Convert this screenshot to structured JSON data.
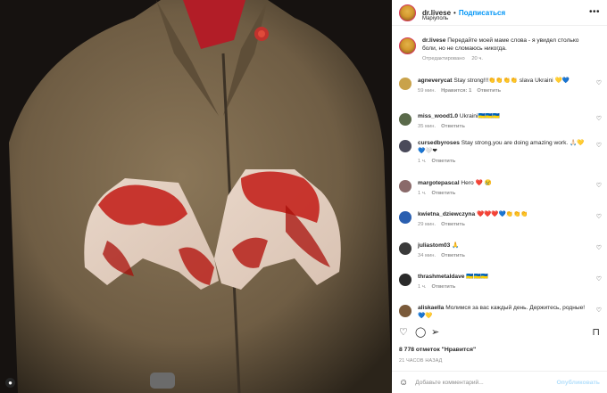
{
  "post": {
    "username": "dr.livese",
    "follow_label": "Подписаться",
    "location": "Маріуполь",
    "caption": "Передайте моей маме слова - я увидел столько боли, но не сломаюсь никогда.",
    "edited": "Отредактировано",
    "caption_time": "20 ч."
  },
  "comments": [
    {
      "user": "agneverycat",
      "text": "Stay strong!!!👏👏👏👏 slava Ukraini 💛💙",
      "time": "59 мин.",
      "likes": "Нравится: 1",
      "reply": "Ответить",
      "avatar_color": "#c9a24a"
    },
    {
      "user": "miss_wood1.0",
      "text": "Ukraini🇺🇦🇺🇦🇺🇦",
      "time": "35 мин.",
      "likes": "",
      "reply": "Ответить",
      "avatar_color": "#5a6a4a"
    },
    {
      "user": "cursedbyroses",
      "text": "Stay strong,you are doing amazing work. 🙏🏻💛💙🤍❤",
      "time": "1 ч.",
      "likes": "",
      "reply": "Ответить",
      "avatar_color": "#4a4a5a"
    },
    {
      "user": "margotepascal",
      "text": "Hero ❤️ 😢",
      "time": "1 ч.",
      "likes": "",
      "reply": "Ответить",
      "avatar_color": "#8a6a6a"
    },
    {
      "user": "kwietna_dziewczyna",
      "text": "❤️❤️❤️💙👏👏👏",
      "time": "29 мин.",
      "likes": "",
      "reply": "Ответить",
      "avatar_color": "#2a5fb0"
    },
    {
      "user": "juliastom03",
      "text": "🙏",
      "time": "34 мин.",
      "likes": "",
      "reply": "Ответить",
      "avatar_color": "#3a3a3a"
    },
    {
      "user": "thrashmetaldave",
      "text": "🇺🇦🇺🇦🇺🇦",
      "time": "1 ч.",
      "likes": "",
      "reply": "Ответить",
      "avatar_color": "#2a2a2a"
    },
    {
      "user": "aliskaella",
      "text": "Молимся за вас каждый день. Держитесь, родные! 💙💛",
      "time": "",
      "likes": "",
      "reply": "",
      "avatar_color": "#7a5a3a"
    }
  ],
  "actions": {
    "likes": "8 778 отметок \"Нравится\"",
    "timestamp": "21 ЧАСОВ НАЗАД",
    "add_comment_placeholder": "Добавьте комментарий...",
    "publish": "Опубликовать"
  },
  "icons": {
    "heart": "heart-icon",
    "comment": "comment-icon",
    "share": "share-icon",
    "save": "bookmark-icon",
    "more": "more-icon",
    "smile": "emoji-icon",
    "person": "user-tag-icon"
  },
  "colors": {
    "link": "#0095f6",
    "muted": "#8e8e8e",
    "text": "#262626"
  }
}
